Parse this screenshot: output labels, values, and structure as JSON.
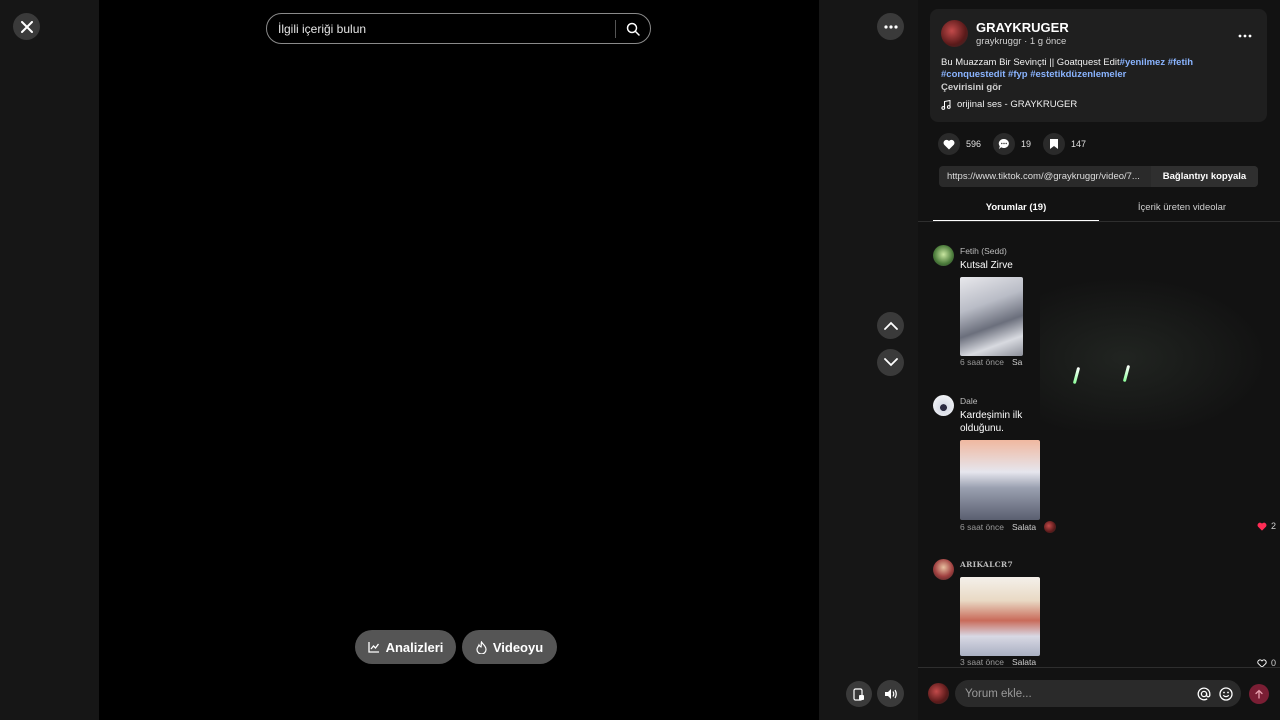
{
  "search": {
    "placeholder": "İlgili içeriği bulun"
  },
  "video": {
    "analytics_label": "Analizleri",
    "promote_label": "Videoyu"
  },
  "author": {
    "name": "GRAYKRUGER",
    "handle": "graykruggr",
    "separator": "·",
    "time": "1 g önce"
  },
  "description": {
    "text": "Bu Muazzam Bir Sevinçti || Goatquest Edit",
    "tags": [
      "#yenilmez",
      "#fetih",
      "#conquestedit",
      "#fyp",
      "#estetikdüzenlemeler"
    ],
    "see_translation": "Çevirisini gör"
  },
  "music": {
    "label": "orijinal ses - GRAYKRUGER"
  },
  "stats": {
    "likes": "596",
    "comments": "19",
    "saves": "147"
  },
  "link": {
    "url": "https://www.tiktok.com/@graykruggr/video/7...",
    "copy_label": "Bağlantıyı kopyala"
  },
  "tabs": [
    {
      "label": "Yorumlar (19)",
      "active": true
    },
    {
      "label": "İçerik üreten videolar",
      "active": false
    }
  ],
  "comments": [
    {
      "user": "Fetih (Sedd)",
      "text": "Kutsal Zirve",
      "time": "6 saat önce",
      "reply": "Sa",
      "likes": ""
    },
    {
      "user": "Dale",
      "text_line1": "Kardeşimin ilk",
      "text_line2": "olduğunu.",
      "time": "6 saat önce",
      "reply": "Salata",
      "likes": "2"
    },
    {
      "user": "ARIKALCR7",
      "time": "3 saat önce",
      "reply": "Salata",
      "likes": "0"
    }
  ],
  "comment_box": {
    "placeholder": "Yorum ekle..."
  },
  "colors": {
    "accent": "#fe2c55",
    "tag": "#8ab4ff",
    "panel_bg": "#121212",
    "card_bg": "#1f1f1f"
  }
}
